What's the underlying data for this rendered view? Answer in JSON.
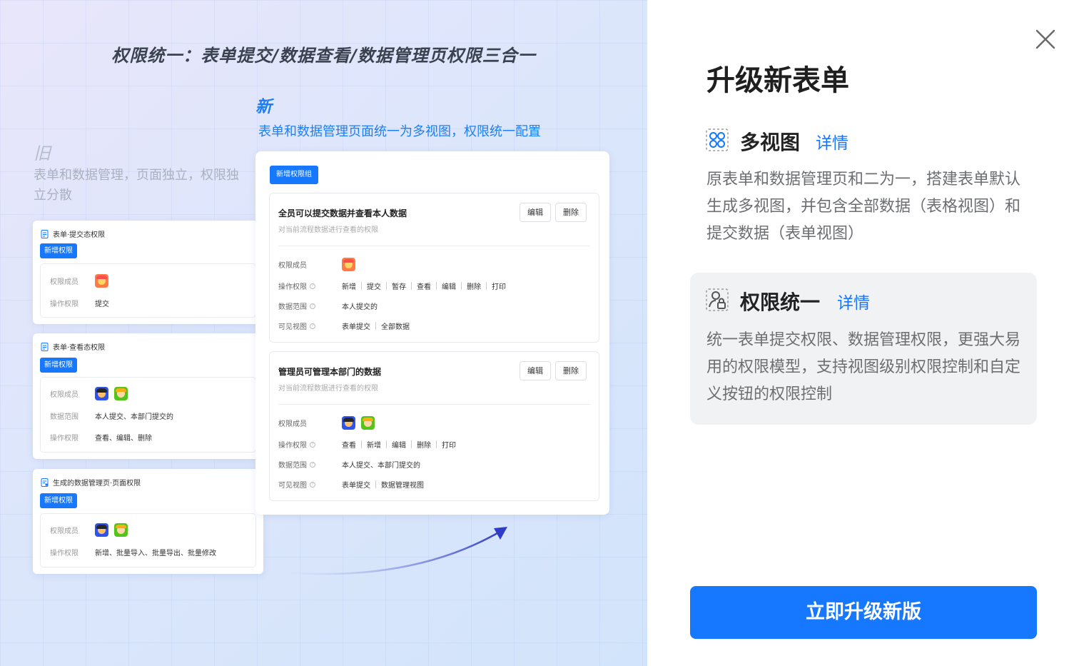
{
  "hero": {
    "title": "权限统一：表单提交/数据查看/数据管理页权限三合一",
    "new_tag": "新",
    "new_subtitle": "表单和数据管理页面统一为多视图，权限统一配置",
    "old_tag": "旧",
    "old_subtitle": "表单和数据管理，页面独立，权限独立分散"
  },
  "old_cards": [
    {
      "title": "表单·提交态权限",
      "add_label": "新增权限",
      "rows": [
        {
          "key": "权限成员",
          "value": ""
        },
        {
          "key": "操作权限",
          "value": "提交"
        }
      ]
    },
    {
      "title": "表单·查看态权限",
      "add_label": "新增权限",
      "rows": [
        {
          "key": "权限成员",
          "value": ""
        },
        {
          "key": "数据范围",
          "value": "本人提交、本部门提交的"
        },
        {
          "key": "操作权限",
          "value": "查看、编辑、删除"
        }
      ]
    },
    {
      "title": "生成的数据管理页·页面权限",
      "add_label": "新增权限",
      "rows": [
        {
          "key": "权限成员",
          "value": ""
        },
        {
          "key": "操作权限",
          "value": "新增、批量导入、批量导出、批量修改"
        }
      ]
    }
  ],
  "new_card": {
    "add_group_label": "新增权限组",
    "groups": [
      {
        "title": "全员可以提交数据并查看本人数据",
        "desc": "对当前流程数据进行查看的权限",
        "edit_label": "编辑",
        "delete_label": "删除",
        "labels": [
          "权限成员",
          "操作权限",
          "数据范围",
          "可见视图"
        ],
        "ops": [
          "新增",
          "提交",
          "暂存",
          "查看",
          "编辑",
          "删除",
          "打印"
        ],
        "scope": "本人提交的",
        "views": [
          "表单提交",
          "全部数据"
        ]
      },
      {
        "title": "管理员可管理本部门的数据",
        "desc": "对当前流程数据进行查看的权限",
        "edit_label": "编辑",
        "delete_label": "删除",
        "labels": [
          "权限成员",
          "操作权限",
          "数据范围",
          "可见视图"
        ],
        "ops": [
          "查看",
          "新增",
          "编辑",
          "删除",
          "打印"
        ],
        "scope": "本人提交、本部门提交的",
        "views": [
          "表单提交",
          "数据管理视图"
        ]
      }
    ]
  },
  "panel": {
    "title": "升级新表单",
    "features": [
      {
        "title": "多视图",
        "link": "详情",
        "icon": "multi-view-icon",
        "desc": "原表单和数据管理页和二为一，搭建表单默认生成多视图，并包含全部数据（表格视图）和提交数据（表单视图）"
      },
      {
        "title": "权限统一",
        "link": "详情",
        "icon": "permission-icon",
        "desc": "统一表单提交权限、数据管理权限，更强大易用的权限模型，支持视图级别权限控制和自定义按钮的权限控制"
      }
    ],
    "cta": "立即升级新版"
  },
  "colors": {
    "accent": "#1677ff",
    "text_dark": "#1f1f1f",
    "text_muted": "#6c6e72",
    "feature_bg": "#f1f2f4"
  }
}
